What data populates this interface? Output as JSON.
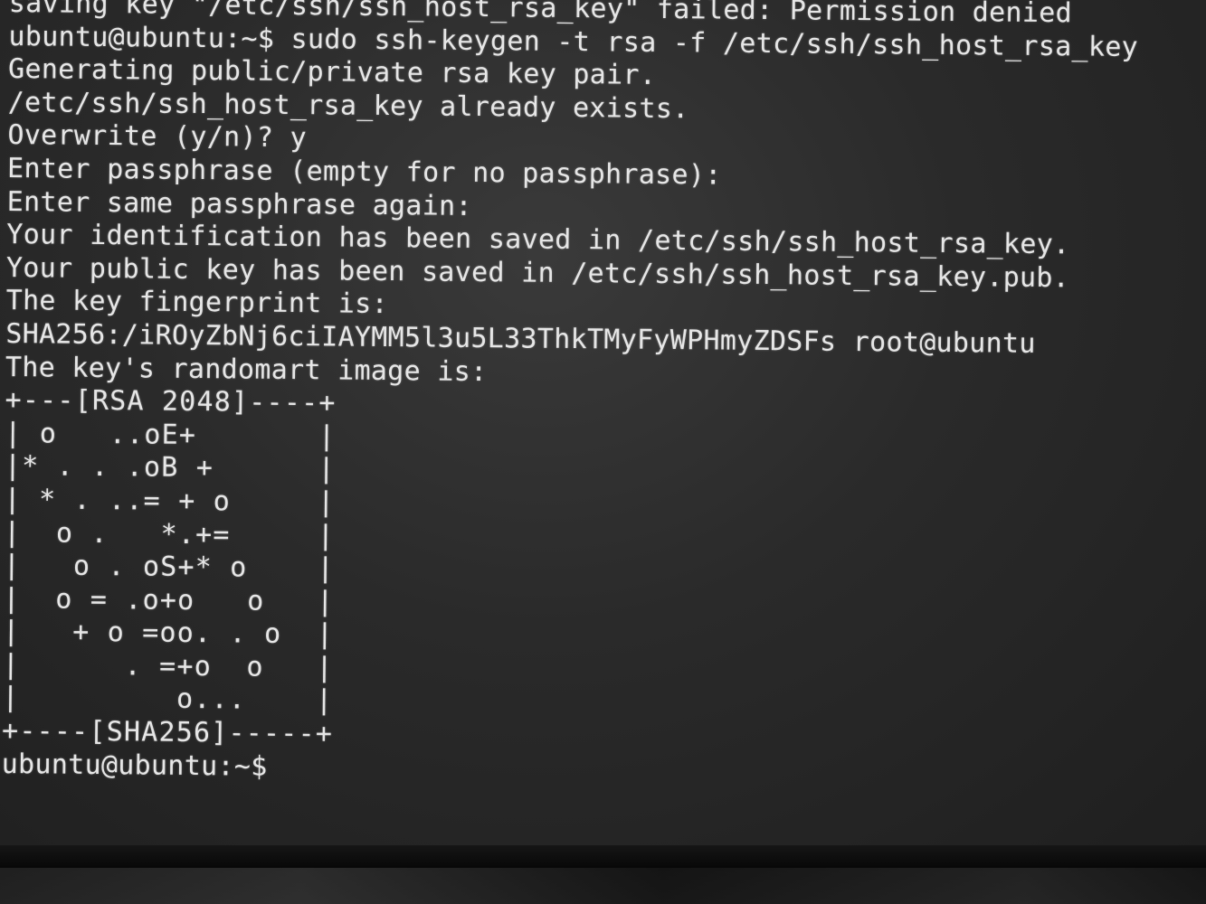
{
  "terminal": {
    "lines": [
      "saving key \"/etc/ssh/ssh_host_rsa_key\" failed: Permission denied",
      "ubuntu@ubuntu:~$ sudo ssh-keygen -t rsa -f /etc/ssh/ssh_host_rsa_key",
      "Generating public/private rsa key pair.",
      "/etc/ssh/ssh_host_rsa_key already exists.",
      "Overwrite (y/n)? y",
      "Enter passphrase (empty for no passphrase):",
      "Enter same passphrase again:",
      "Your identification has been saved in /etc/ssh/ssh_host_rsa_key.",
      "Your public key has been saved in /etc/ssh/ssh_host_rsa_key.pub.",
      "The key fingerprint is:",
      "SHA256:/iROyZbNj6ciIAYMM5l3u5L33ThkTMyFyWPHmyZDSFs root@ubuntu",
      "The key's randomart image is:"
    ],
    "randomart": [
      "+---[RSA 2048]----+",
      "| o   ..oE+       |",
      "|* . . .oB +      |",
      "| * . ..= + o     |",
      "|  o .   *.+=     |",
      "|   o . oS+* o    |",
      "|  o = .o+o   o   |",
      "|   + o =oo. . o  |",
      "|      . =+o  o   |",
      "|         o...    |",
      "+----[SHA256]-----+"
    ],
    "prompt": "ubuntu@ubuntu:~$"
  }
}
